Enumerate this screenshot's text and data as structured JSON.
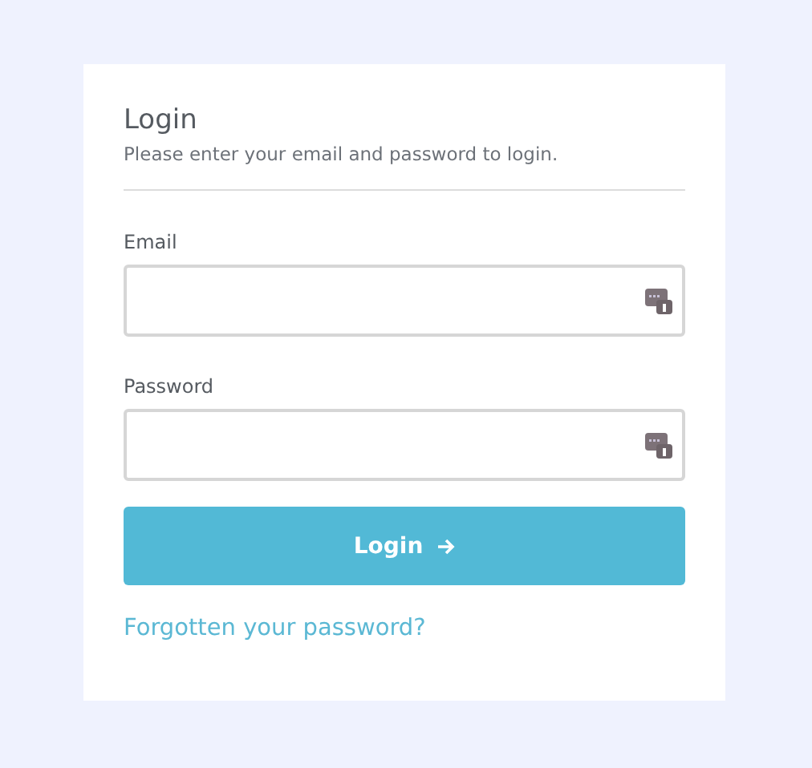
{
  "login_card": {
    "title": "Login",
    "subtitle": "Please enter your email and password to login.",
    "fields": [
      {
        "label": "Email"
      },
      {
        "label": "Password"
      }
    ],
    "submit": {
      "label": "Login"
    },
    "forgot_link": "Forgotten your password?"
  }
}
